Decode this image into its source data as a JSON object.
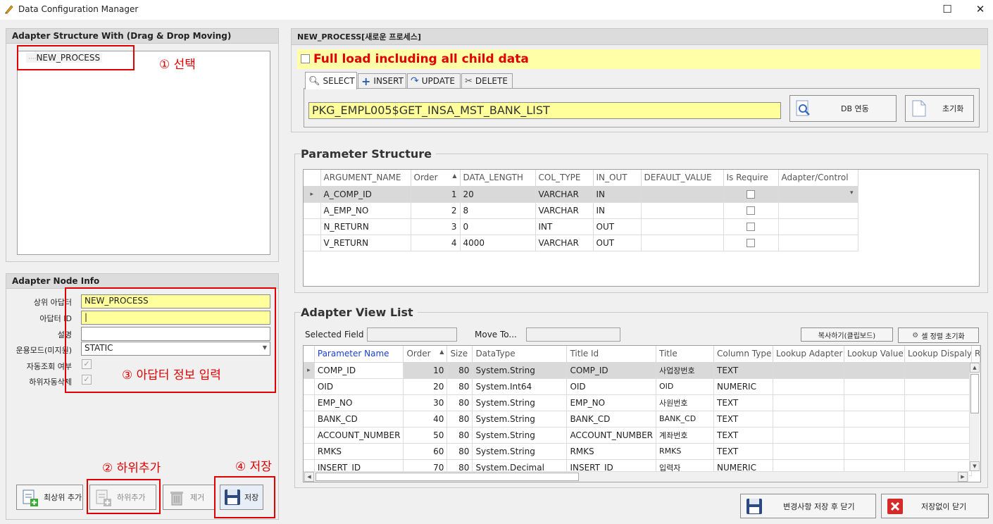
{
  "window": {
    "title": "Data Configuration Manager",
    "maximize_glyph": "☐",
    "close_glyph": "✕"
  },
  "left": {
    "structure_header": "Adapter Structure With (Drag & Drop Moving)",
    "tree_item": "NEW_PROCESS",
    "node_info_header": "Adapter Node Info",
    "fields": {
      "parent_label": "상위 아답터",
      "parent_value": "NEW_PROCESS",
      "id_label": "아답터 ID",
      "id_value": "|",
      "desc_label": "설명",
      "desc_value": "",
      "mode_label": "운용모드(미지원)",
      "mode_value": "STATIC",
      "autoquery_label": "자동조회 여부",
      "autodelete_label": "하위자동삭제"
    },
    "buttons": {
      "add_top": "최상위 추가",
      "add_child": "하위추가",
      "remove": "제거",
      "save": "저장"
    }
  },
  "annotations": {
    "a1": "① 선택",
    "a2": "② 하위추가",
    "a3": "③ 아답터 정보 입력",
    "a4": "④ 저장"
  },
  "right": {
    "process_header": "NEW_PROCESS[새로운 프로세스]",
    "full_load_label": "Full load including all child data",
    "tabs": [
      "SELECT",
      "INSERT",
      "UPDATE",
      "DELETE"
    ],
    "procedure": "PKG_EMPL005$GET_INSA_MST_BANK_LIST",
    "db_btn": "DB 연동",
    "init_btn": "초기화",
    "param_title": "Parameter Structure",
    "param_columns": [
      "ARGUMENT_NAME",
      "Order",
      "DATA_LENGTH",
      "COL_TYPE",
      "IN_OUT",
      "DEFAULT_VALUE",
      "Is Require",
      "Adapter/Control"
    ],
    "param_rows": [
      [
        "A_COMP_ID",
        "1",
        "20",
        "VARCHAR",
        "IN",
        "",
        "",
        ""
      ],
      [
        "A_EMP_NO",
        "2",
        "8",
        "VARCHAR",
        "IN",
        "",
        "",
        ""
      ],
      [
        "N_RETURN",
        "3",
        "0",
        "INT",
        "OUT",
        "",
        "",
        ""
      ],
      [
        "V_RETURN",
        "4",
        "4000",
        "VARCHAR",
        "OUT",
        "",
        "",
        ""
      ]
    ],
    "view_title": "Adapter View List",
    "selected_field_label": "Selected Field",
    "move_to_label": "Move To...",
    "copy_btn": "복사하기(클립보드)",
    "cell_reset_btn": "셀 정렬 초기화",
    "view_columns": [
      "Parameter Name",
      "Order",
      "Size",
      "DataType",
      "Title Id",
      "Title",
      "Column Type",
      "Lookup Adapter",
      "Lookup Value",
      "Lookup Dispaly",
      "R"
    ],
    "view_rows": [
      [
        "COMP_ID",
        "10",
        "80",
        "System.String",
        "COMP_ID",
        "사업장번호",
        "TEXT"
      ],
      [
        "OID",
        "20",
        "80",
        "System.Int64",
        "OID",
        "OID",
        "NUMERIC"
      ],
      [
        "EMP_NO",
        "30",
        "80",
        "System.String",
        "EMP_NO",
        "사원번호",
        "TEXT"
      ],
      [
        "BANK_CD",
        "40",
        "80",
        "System.String",
        "BANK_CD",
        "BANK_CD",
        "TEXT"
      ],
      [
        "ACCOUNT_NUMBER",
        "50",
        "80",
        "System.String",
        "ACCOUNT_NUMBER",
        "계좌번호",
        "TEXT"
      ],
      [
        "RMKS",
        "60",
        "80",
        "System.String",
        "RMKS",
        "RMKS",
        "TEXT"
      ],
      [
        "INSERT_ID",
        "70",
        "80",
        "System.Decimal",
        "INSERT_ID",
        "입력자",
        "NUMERIC"
      ]
    ],
    "save_close_btn": "변경사항 저장 후 닫기",
    "close_nosave_btn": "저장없이 닫기"
  },
  "colors": {
    "annotation": "#e00000",
    "highlight": "#ffff9c",
    "param_name_header": "#1a3fd0"
  }
}
